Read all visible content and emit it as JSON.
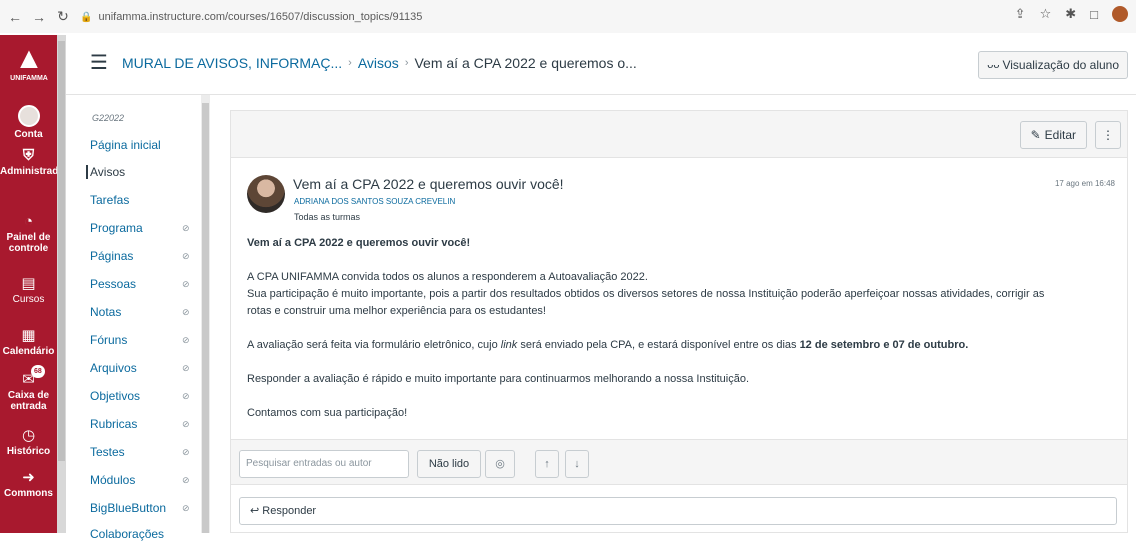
{
  "browser": {
    "url": "unifamma.instructure.com/courses/16507/discussion_topics/91135"
  },
  "global_nav": {
    "logo_text": "UNIFAMMA",
    "items": [
      {
        "label": "Conta"
      },
      {
        "label": "Administrador"
      },
      {
        "label": "Painel de controle"
      },
      {
        "label": "Cursos"
      },
      {
        "label": "Calendário"
      },
      {
        "label": "Caixa de entrada",
        "badge": "68"
      },
      {
        "label": "Histórico"
      },
      {
        "label": "Commons"
      }
    ]
  },
  "header": {
    "breadcrumb": [
      "MURAL DE AVISOS, INFORMAÇ...",
      "Avisos",
      "Vem aí a CPA 2022 e queremos o..."
    ],
    "student_view_label": "Visualização do aluno"
  },
  "course_nav": {
    "term": "G22022",
    "items": [
      {
        "label": "Página inicial",
        "active": false,
        "hidden": false
      },
      {
        "label": "Avisos",
        "active": true,
        "hidden": false
      },
      {
        "label": "Tarefas",
        "active": false,
        "hidden": false
      },
      {
        "label": "Programa",
        "active": false,
        "hidden": true
      },
      {
        "label": "Páginas",
        "active": false,
        "hidden": true
      },
      {
        "label": "Pessoas",
        "active": false,
        "hidden": true
      },
      {
        "label": "Notas",
        "active": false,
        "hidden": true
      },
      {
        "label": "Fóruns",
        "active": false,
        "hidden": true
      },
      {
        "label": "Arquivos",
        "active": false,
        "hidden": true
      },
      {
        "label": "Objetivos",
        "active": false,
        "hidden": true
      },
      {
        "label": "Rubricas",
        "active": false,
        "hidden": true
      },
      {
        "label": "Testes",
        "active": false,
        "hidden": true
      },
      {
        "label": "Módulos",
        "active": false,
        "hidden": true
      },
      {
        "label": "BigBlueButton",
        "active": false,
        "hidden": true
      },
      {
        "label": "Colaborações",
        "active": false,
        "hidden": true
      }
    ]
  },
  "topbar": {
    "edit_label": "Editar"
  },
  "post": {
    "title": "Vem aí a CPA 2022 e queremos ouvir você!",
    "author": "ADRIANA DOS SANTOS SOUZA CREVELIN",
    "sections": "Todas as turmas",
    "date": "17 ago em 16:48",
    "body": {
      "heading": "Vem aí a CPA 2022 e queremos ouvir você!",
      "p1_line1": "A CPA UNIFAMMA convida todos os alunos a responderem a Autoavaliação 2022.",
      "p1_line2": "Sua participação é muito importante, pois a partir dos resultados obtidos os diversos setores de nossa Instituição poderão aperfeiçoar nossas atividades, corrigir as",
      "p1_line3": "rotas e construir uma melhor experiência para os estudantes!",
      "p2_a": "A avaliação será feita via formulário eletrônico, cujo ",
      "p2_link": "link",
      "p2_b": " será enviado pela CPA, e estará disponível entre os dias ",
      "p2_dates": "12 de setembro e 07 de outubro.",
      "p3": "Responder a avaliação é rápido e muito importante para continuarmos melhorando a nossa Instituição.",
      "p4": "Contamos com sua participação!"
    }
  },
  "toolbar": {
    "search_placeholder": "Pesquisar entradas ou autor",
    "unread_label": "Não lido"
  },
  "reply": {
    "label": "Responder"
  }
}
